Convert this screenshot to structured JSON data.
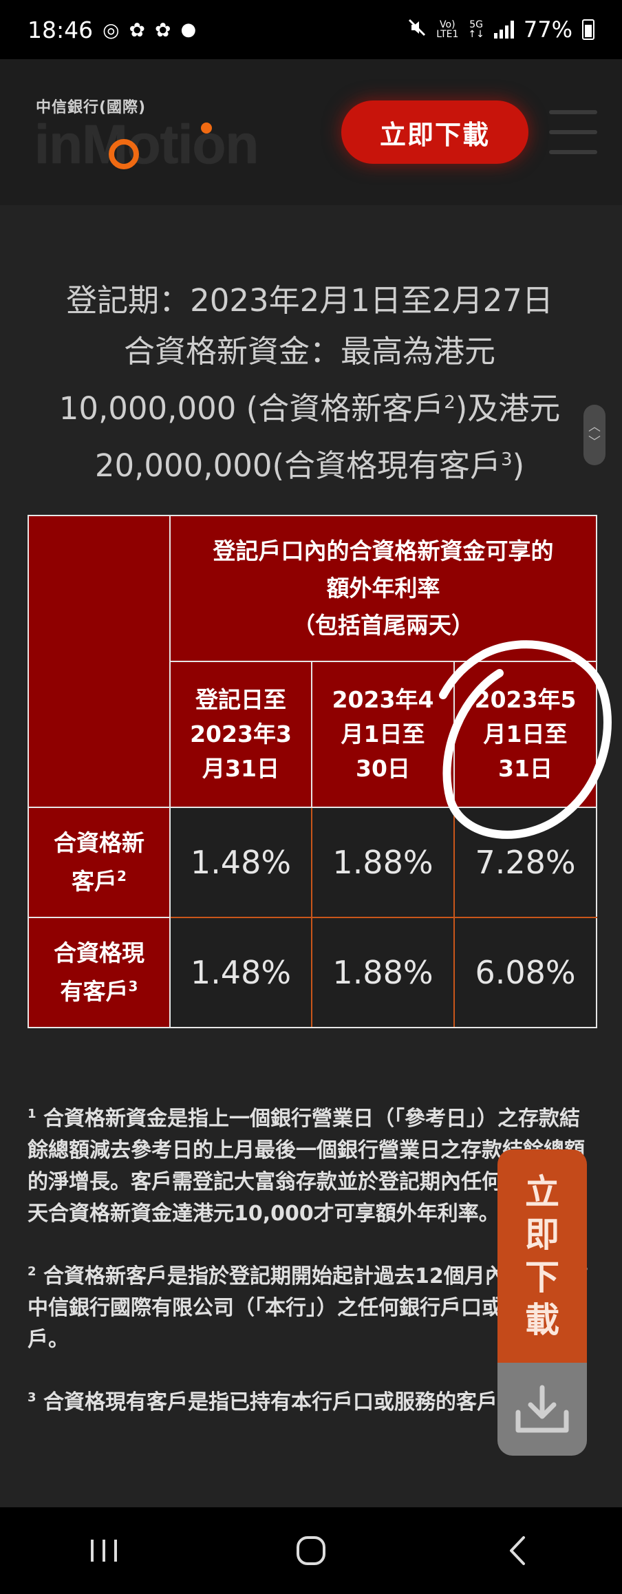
{
  "status_bar": {
    "time": "18:46",
    "battery": "77%",
    "net_top": "Vo)",
    "net_bottom": "LTE1",
    "net_5g": "5G",
    "icons": [
      "whatsapp-icon",
      "weibo-icon",
      "weibo-icon",
      "dot-icon",
      "mute-icon",
      "signal-icon",
      "battery-icon"
    ]
  },
  "header": {
    "logo_top": "中信銀行(國際)",
    "logo_word": "inMotion",
    "download_label": "立即下載"
  },
  "intro": {
    "line1": "登記期：2023年2月1日至2月27日",
    "line2": "合資格新資金：最高為港元",
    "line3a": "10,000,000 (合資格新客戶",
    "line3sup": "2",
    "line3b": ")及港元",
    "line4a": "20,000,000(合資格現有客戶",
    "line4sup": "3",
    "line4b": ")"
  },
  "table": {
    "head_main_1": "登記戶口內的合資格新資金可享的",
    "head_main_2": "額外年利率",
    "head_main_3": "（包括首尾兩天）",
    "periods": [
      [
        "登記日至",
        "2023年3",
        "月31日"
      ],
      [
        "2023年4",
        "月1日至",
        "30日"
      ],
      [
        "2023年5",
        "月1日至",
        "31日"
      ]
    ],
    "rows": [
      {
        "label_1": "合資格新",
        "label_2": "客戶",
        "sup": "2",
        "values": [
          "1.48%",
          "1.88%",
          "7.28%"
        ]
      },
      {
        "label_1": "合資格現",
        "label_2": "有客戶",
        "sup": "3",
        "values": [
          "1.48%",
          "1.88%",
          "6.08%"
        ]
      }
    ]
  },
  "footnotes": [
    {
      "num": "1",
      "text": "合資格新資金是指上一個銀行營業日（「參考日」）之存款結餘總額減去參考日的上月最後一個銀行營業日之存款結餘總額的淨增長。客戶需登記大富翁存款並於登記期內任何一個工作天合資格新資金達港元10,000才可享額外年利率。"
    },
    {
      "num": "2",
      "text": "合資格新客戶是指於登記期開始起計過去12個月內沒有持有中信銀行國際有限公司（「本行」）之任何銀行戶口或服務的客戶。"
    },
    {
      "num": "3",
      "text": "合資格現有客戶是指已持有本行戶口或服務的客戶。"
    }
  ],
  "float_download": {
    "chars": [
      "立",
      "即",
      "下",
      "載"
    ]
  },
  "colors": {
    "accent_red": "#c8140b",
    "table_red": "#8f0000",
    "logo_orange": "#f06a12",
    "float_orange": "#c44a1a"
  }
}
